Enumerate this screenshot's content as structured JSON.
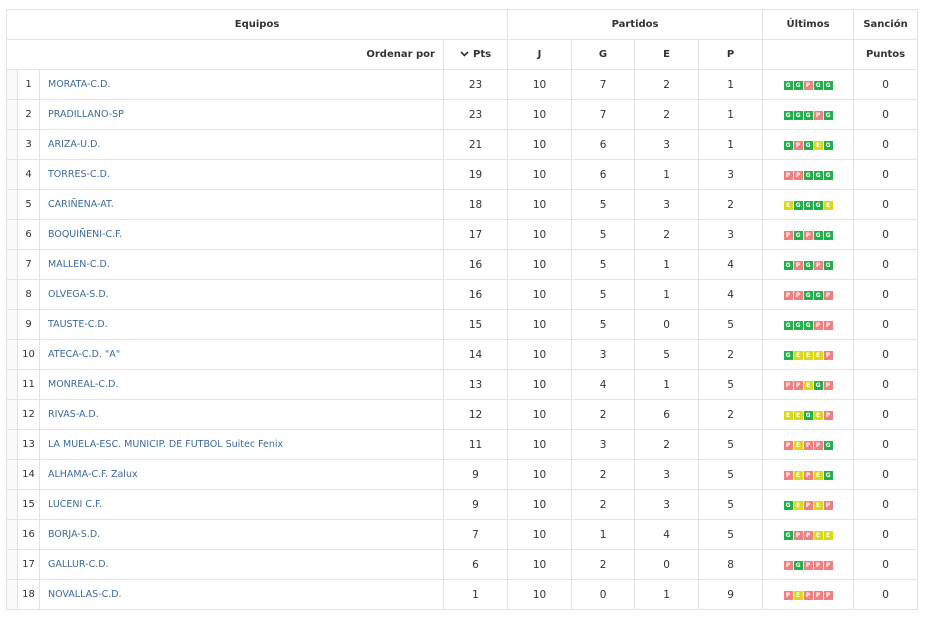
{
  "header": {
    "equipos": "Equipos",
    "partidos": "Partidos",
    "ultimos": "Últimos",
    "sancion": "Sanción",
    "ordenar_por": "Ordenar por",
    "pts": "Pts",
    "j": "J",
    "g": "G",
    "e": "E",
    "p": "P",
    "puntos": "Puntos"
  },
  "form_colors": {
    "G": "#20b14a",
    "P": "#f08080",
    "E": "#d9d916"
  },
  "rows": [
    {
      "pos": "1",
      "team": "MORATA-C.D.",
      "pts": "23",
      "j": "10",
      "g": "7",
      "e": "2",
      "p": "1",
      "last": [
        "G",
        "G",
        "P",
        "G",
        "G"
      ],
      "sancion": "0"
    },
    {
      "pos": "2",
      "team": "PRADILLANO-SP",
      "pts": "23",
      "j": "10",
      "g": "7",
      "e": "2",
      "p": "1",
      "last": [
        "G",
        "G",
        "G",
        "P",
        "G"
      ],
      "sancion": "0"
    },
    {
      "pos": "3",
      "team": "ARIZA-U.D.",
      "pts": "21",
      "j": "10",
      "g": "6",
      "e": "3",
      "p": "1",
      "last": [
        "G",
        "P",
        "G",
        "E",
        "G"
      ],
      "sancion": "0"
    },
    {
      "pos": "4",
      "team": "TORRES-C.D.",
      "pts": "19",
      "j": "10",
      "g": "6",
      "e": "1",
      "p": "3",
      "last": [
        "P",
        "P",
        "G",
        "G",
        "G"
      ],
      "sancion": "0"
    },
    {
      "pos": "5",
      "team": "CARIÑENA-AT.",
      "pts": "18",
      "j": "10",
      "g": "5",
      "e": "3",
      "p": "2",
      "last": [
        "E",
        "G",
        "G",
        "G",
        "E"
      ],
      "sancion": "0"
    },
    {
      "pos": "6",
      "team": "BOQUIÑENI-C.F.",
      "pts": "17",
      "j": "10",
      "g": "5",
      "e": "2",
      "p": "3",
      "last": [
        "P",
        "G",
        "P",
        "G",
        "G"
      ],
      "sancion": "0"
    },
    {
      "pos": "7",
      "team": "MALLEN-C.D.",
      "pts": "16",
      "j": "10",
      "g": "5",
      "e": "1",
      "p": "4",
      "last": [
        "G",
        "P",
        "G",
        "P",
        "G"
      ],
      "sancion": "0"
    },
    {
      "pos": "8",
      "team": "OLVEGA-S.D.",
      "pts": "16",
      "j": "10",
      "g": "5",
      "e": "1",
      "p": "4",
      "last": [
        "P",
        "P",
        "G",
        "G",
        "P"
      ],
      "sancion": "0"
    },
    {
      "pos": "9",
      "team": "TAUSTE-C.D.",
      "pts": "15",
      "j": "10",
      "g": "5",
      "e": "0",
      "p": "5",
      "last": [
        "G",
        "G",
        "G",
        "P",
        "P"
      ],
      "sancion": "0"
    },
    {
      "pos": "10",
      "team": "ATECA-C.D. \"A\"",
      "pts": "14",
      "j": "10",
      "g": "3",
      "e": "5",
      "p": "2",
      "last": [
        "G",
        "E",
        "E",
        "E",
        "P"
      ],
      "sancion": "0"
    },
    {
      "pos": "11",
      "team": "MONREAL-C.D.",
      "pts": "13",
      "j": "10",
      "g": "4",
      "e": "1",
      "p": "5",
      "last": [
        "P",
        "P",
        "E",
        "G",
        "P"
      ],
      "sancion": "0"
    },
    {
      "pos": "12",
      "team": "RIVAS-A.D.",
      "pts": "12",
      "j": "10",
      "g": "2",
      "e": "6",
      "p": "2",
      "last": [
        "E",
        "E",
        "G",
        "E",
        "P"
      ],
      "sancion": "0"
    },
    {
      "pos": "13",
      "team": "LA MUELA-ESC. MUNICIP. DE FUTBOL Suitec Fenix",
      "pts": "11",
      "j": "10",
      "g": "3",
      "e": "2",
      "p": "5",
      "last": [
        "P",
        "E",
        "P",
        "P",
        "G"
      ],
      "sancion": "0"
    },
    {
      "pos": "14",
      "team": "ALHAMA-C.F. Zalux",
      "pts": "9",
      "j": "10",
      "g": "2",
      "e": "3",
      "p": "5",
      "last": [
        "P",
        "E",
        "P",
        "E",
        "G"
      ],
      "sancion": "0"
    },
    {
      "pos": "15",
      "team": "LUCENI C.F.",
      "pts": "9",
      "j": "10",
      "g": "2",
      "e": "3",
      "p": "5",
      "last": [
        "G",
        "E",
        "P",
        "E",
        "P"
      ],
      "sancion": "0"
    },
    {
      "pos": "16",
      "team": "BORJA-S.D.",
      "pts": "7",
      "j": "10",
      "g": "1",
      "e": "4",
      "p": "5",
      "last": [
        "G",
        "P",
        "P",
        "E",
        "E"
      ],
      "sancion": "0"
    },
    {
      "pos": "17",
      "team": "GALLUR-C.D.",
      "pts": "6",
      "j": "10",
      "g": "2",
      "e": "0",
      "p": "8",
      "last": [
        "P",
        "G",
        "P",
        "P",
        "P"
      ],
      "sancion": "0"
    },
    {
      "pos": "18",
      "team": "NOVALLAS-C.D.",
      "pts": "1",
      "j": "10",
      "g": "0",
      "e": "1",
      "p": "9",
      "last": [
        "P",
        "E",
        "P",
        "P",
        "P"
      ],
      "sancion": "0"
    }
  ]
}
